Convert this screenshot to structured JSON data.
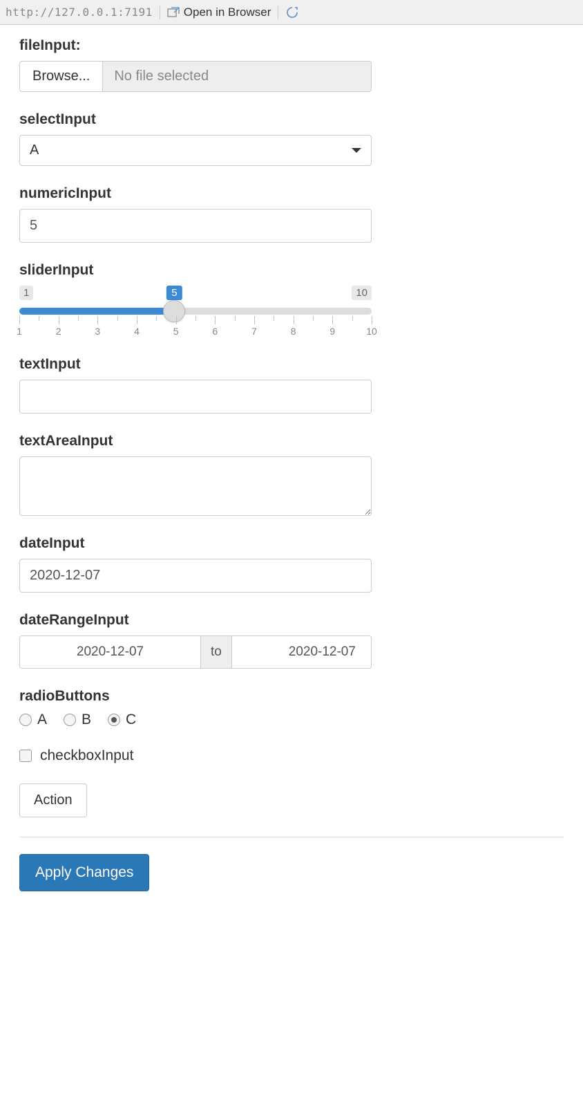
{
  "toolbar": {
    "url": "http://127.0.0.1:7191",
    "open_in_browser": "Open in Browser"
  },
  "fileInput": {
    "label": "fileInput:",
    "browse": "Browse...",
    "status": "No file selected"
  },
  "selectInput": {
    "label": "selectInput",
    "value": "A"
  },
  "numericInput": {
    "label": "numericInput",
    "value": "5"
  },
  "sliderInput": {
    "label": "sliderInput",
    "min": "1",
    "max": "10",
    "value": "5",
    "ticks": [
      "1",
      "2",
      "3",
      "4",
      "5",
      "6",
      "7",
      "8",
      "9",
      "10"
    ]
  },
  "textInput": {
    "label": "textInput",
    "value": ""
  },
  "textAreaInput": {
    "label": "textAreaInput",
    "value": ""
  },
  "dateInput": {
    "label": "dateInput",
    "value": "2020-12-07"
  },
  "dateRangeInput": {
    "label": "dateRangeInput",
    "from": "2020-12-07",
    "sep": "to",
    "to": "2020-12-07"
  },
  "radioButtons": {
    "label": "radioButtons",
    "options": [
      "A",
      "B",
      "C"
    ],
    "selected": "C"
  },
  "checkboxInput": {
    "label": "checkboxInput",
    "checked": false
  },
  "actionButton": {
    "label": "Action"
  },
  "submitButton": {
    "label": "Apply Changes"
  }
}
